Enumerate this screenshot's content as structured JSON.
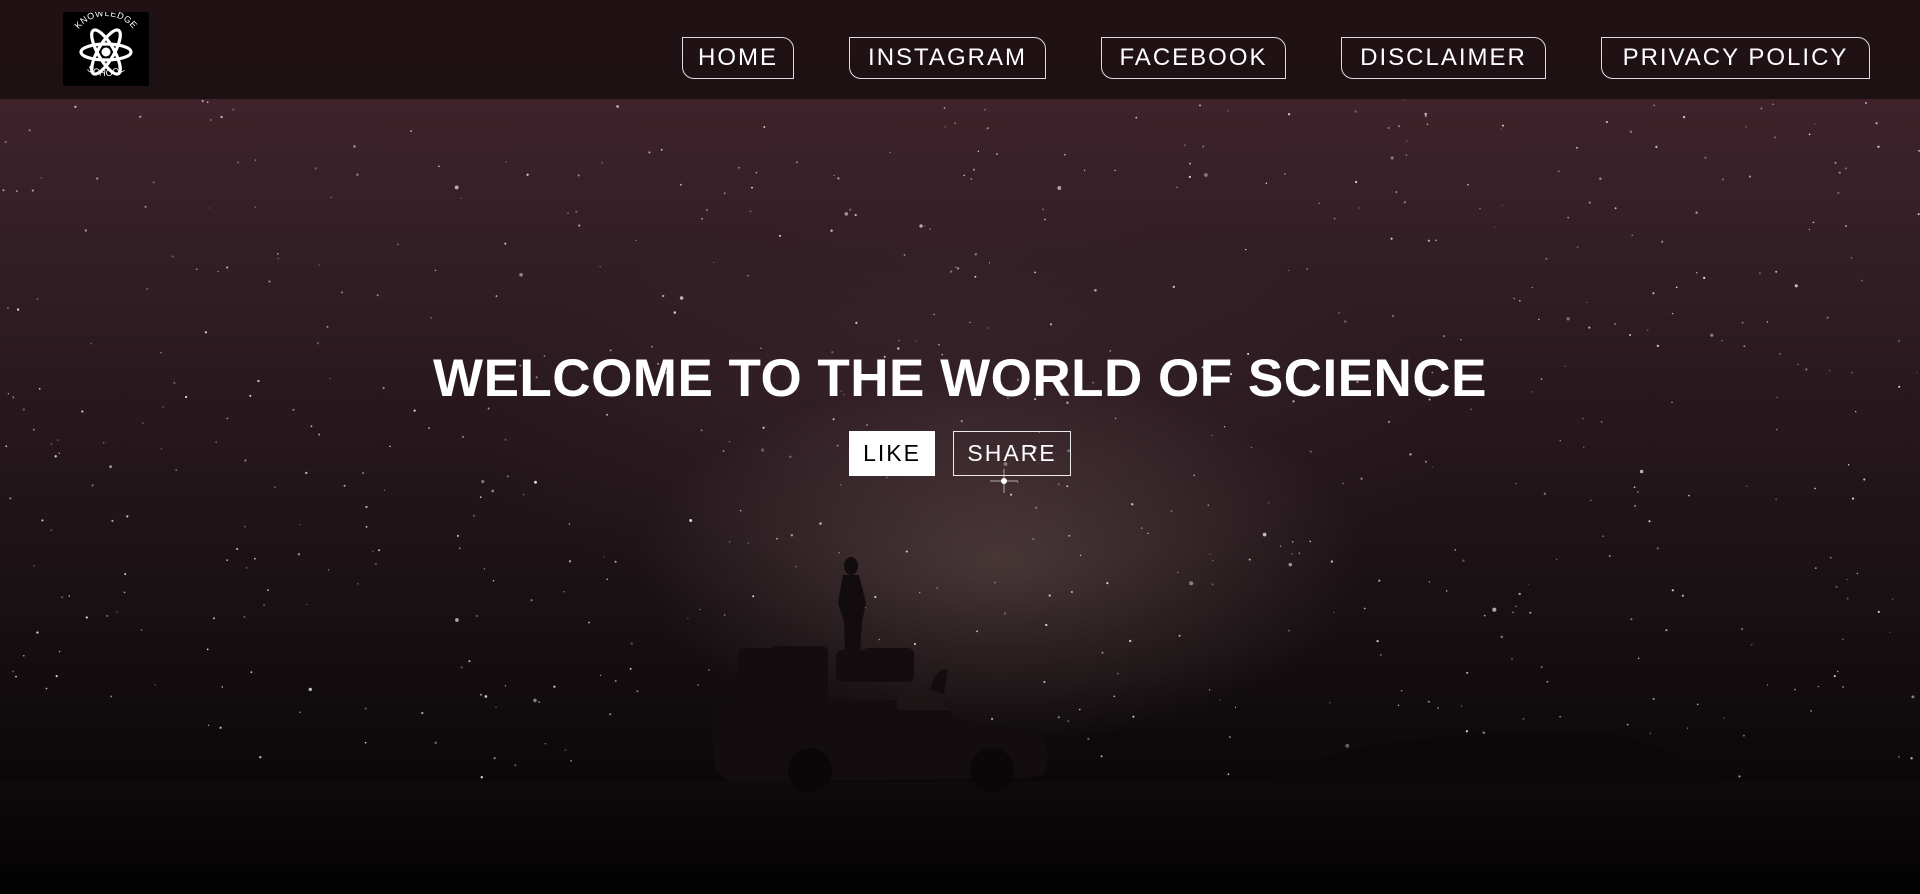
{
  "logo": {
    "icon": "atom-icon",
    "top_text": "KNOWLEDGE",
    "bottom_text": "SCHOOL"
  },
  "nav": {
    "items": [
      {
        "label": "HOME"
      },
      {
        "label": "INSTAGRAM"
      },
      {
        "label": "FACEBOOK"
      },
      {
        "label": "DISCLAIMER"
      },
      {
        "label": "PRIVACY POLICY"
      }
    ]
  },
  "hero": {
    "title": "WELCOME TO THE WORLD OF SCIENCE",
    "like_label": "LIKE",
    "share_label": "SHARE",
    "background": "night-sky-milky-way-with-person-on-truck-silhouette"
  },
  "colors": {
    "header_bg": "#1c1012",
    "sky_top": "#4a2430",
    "sky_bottom": "#050405",
    "text": "#ffffff",
    "like_bg": "#ffffff"
  }
}
